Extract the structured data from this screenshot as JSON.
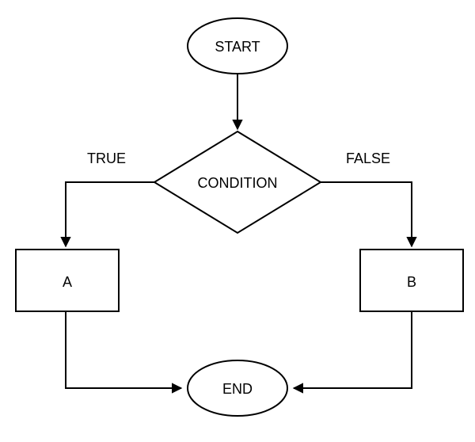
{
  "flowchart": {
    "nodes": {
      "start": "START",
      "condition": "CONDITION",
      "a": "A",
      "b": "B",
      "end": "END"
    },
    "edges": {
      "true_label": "TRUE",
      "false_label": "FALSE"
    }
  }
}
